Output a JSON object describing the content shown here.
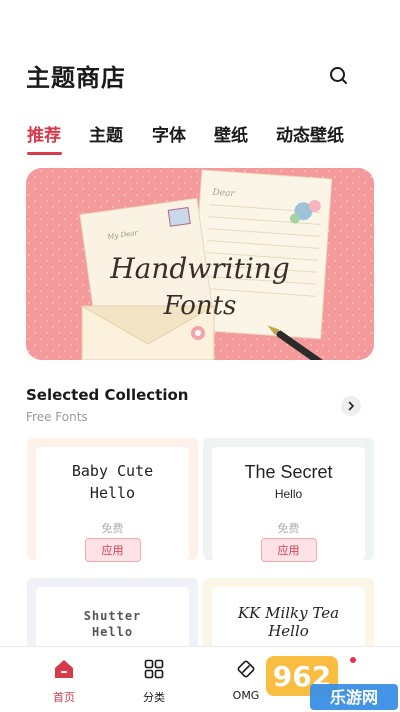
{
  "header": {
    "title": "主题商店",
    "search_icon": "search-icon"
  },
  "tabs": [
    {
      "label": "推荐",
      "active": true
    },
    {
      "label": "主题",
      "active": false
    },
    {
      "label": "字体",
      "active": false
    },
    {
      "label": "壁纸",
      "active": false
    },
    {
      "label": "动态壁纸",
      "active": false
    }
  ],
  "banner": {
    "line1": "Handwriting",
    "line2": "Fonts",
    "letter_label_1": "Dear",
    "letter_label_2": "My Dear"
  },
  "section": {
    "title": "Selected Collection",
    "subtitle": "Free Fonts",
    "more_icon": "chevron-right-icon"
  },
  "cards": [
    {
      "name_line1": "Baby Cute",
      "name_line2": "Hello",
      "price": "免费",
      "apply": "应用"
    },
    {
      "name_line1": "The Secret",
      "name_line2": "Hello",
      "price": "免费",
      "apply": "应用"
    },
    {
      "name_line1": "Shutter",
      "name_line2": "Hello"
    },
    {
      "name_line1": "KK Milky Tea",
      "name_line2": "Hello"
    }
  ],
  "bottom_nav": [
    {
      "label": "首页",
      "icon": "home-icon",
      "active": true
    },
    {
      "label": "分类",
      "icon": "grid-icon",
      "active": false
    },
    {
      "label": "OMG",
      "icon": "diamond-brush-icon",
      "active": false
    }
  ],
  "watermark": {
    "text1": "962",
    "text2": "乐游网"
  },
  "colors": {
    "accent": "#d93a4a",
    "banner_bg": "#f49a9a",
    "apply_bg": "#fde3e6"
  }
}
